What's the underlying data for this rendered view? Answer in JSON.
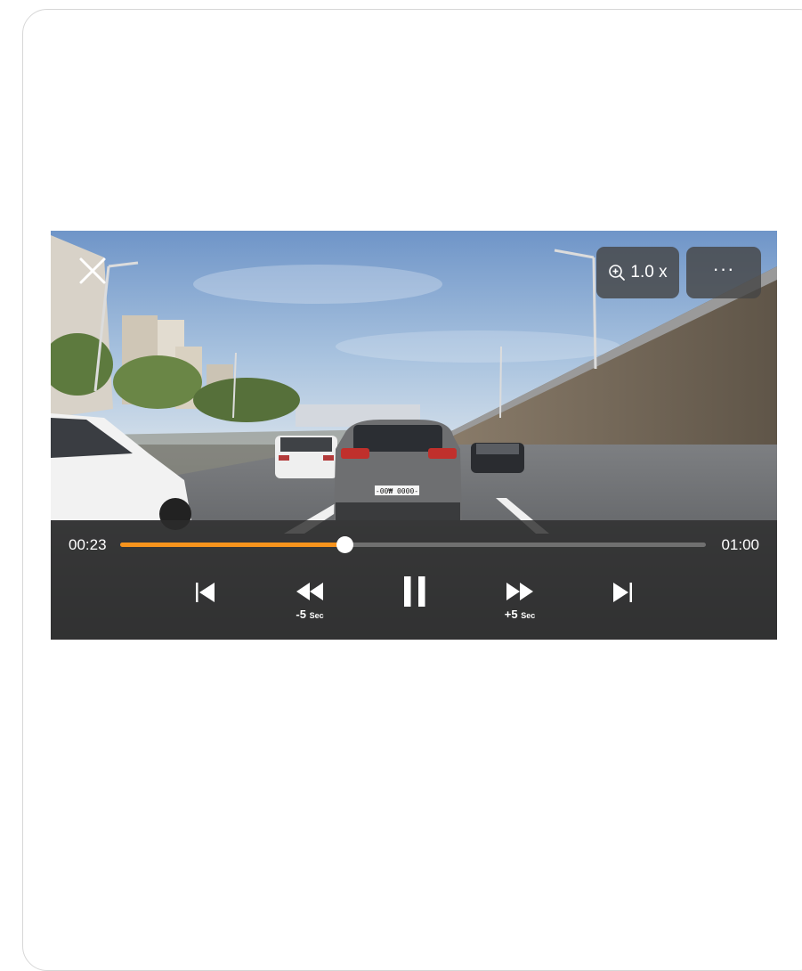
{
  "player": {
    "zoom_label": "1.0 x",
    "more_label": "···",
    "time_current": "00:23",
    "time_total": "01:00",
    "progress": 0.383,
    "skip_back_value": "-5",
    "skip_back_unit": "Sec",
    "skip_forward_value": "+5",
    "skip_forward_unit": "Sec",
    "plate_text": "-00₩ 0000-"
  },
  "icons": {
    "close": "close-icon",
    "zoom": "zoom-in-icon",
    "more": "more-icon",
    "previous": "skip-previous-icon",
    "rewind": "rewind-icon",
    "pause": "pause-icon",
    "forward": "fast-forward-icon",
    "next": "skip-next-icon"
  },
  "colors": {
    "accent": "#f7941d",
    "controls_bg": "#2c2c2c",
    "button_bg": "#464646"
  }
}
